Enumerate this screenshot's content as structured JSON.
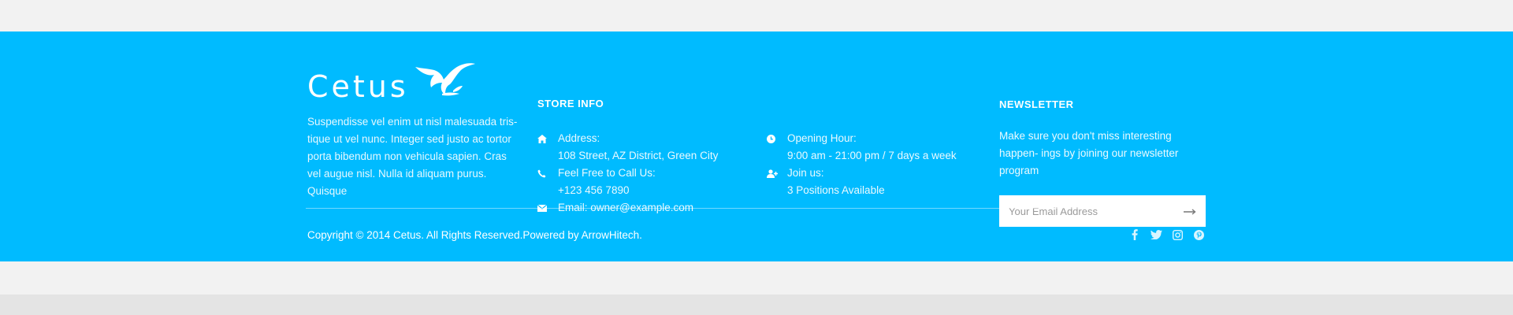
{
  "brand": {
    "logo_text": "Cetus",
    "about": "Suspendisse vel enim ut nisl malesuada tris- tique ut vel nunc. Integer sed justo ac tortor porta bibendum non vehicula sapien. Cras vel augue nisl. Nulla id aliquam purus. Quisque"
  },
  "store_info": {
    "title": "STORE INFO",
    "address_label": "Address:",
    "address_value": "108 Street, AZ District, Green City",
    "call_label": "Feel Free to Call Us:",
    "call_value": "+123 456 7890",
    "email": "Email: owner@example.com"
  },
  "hours": {
    "opening_label": "Opening Hour:",
    "opening_value": "9:00 am - 21:00 pm / 7 days a week",
    "join_label": "Join us:",
    "join_value": "3 Positions Available"
  },
  "newsletter": {
    "title": "NEWSLETTER",
    "description": "Make sure you don't miss interesting happen- ings by joining our newsletter program",
    "placeholder": "Your Email Address"
  },
  "footer_bottom": {
    "copyright": "Copyright © 2014  Cetus. All Rights Reserved.Powered by ArrowHitech."
  },
  "socials": [
    "facebook-icon",
    "twitter-icon",
    "instagram-icon",
    "pinterest-icon"
  ],
  "colors": {
    "footer_bg": "#00bbff",
    "page_bg": "#f2f2f2",
    "text": "#ffffff"
  }
}
